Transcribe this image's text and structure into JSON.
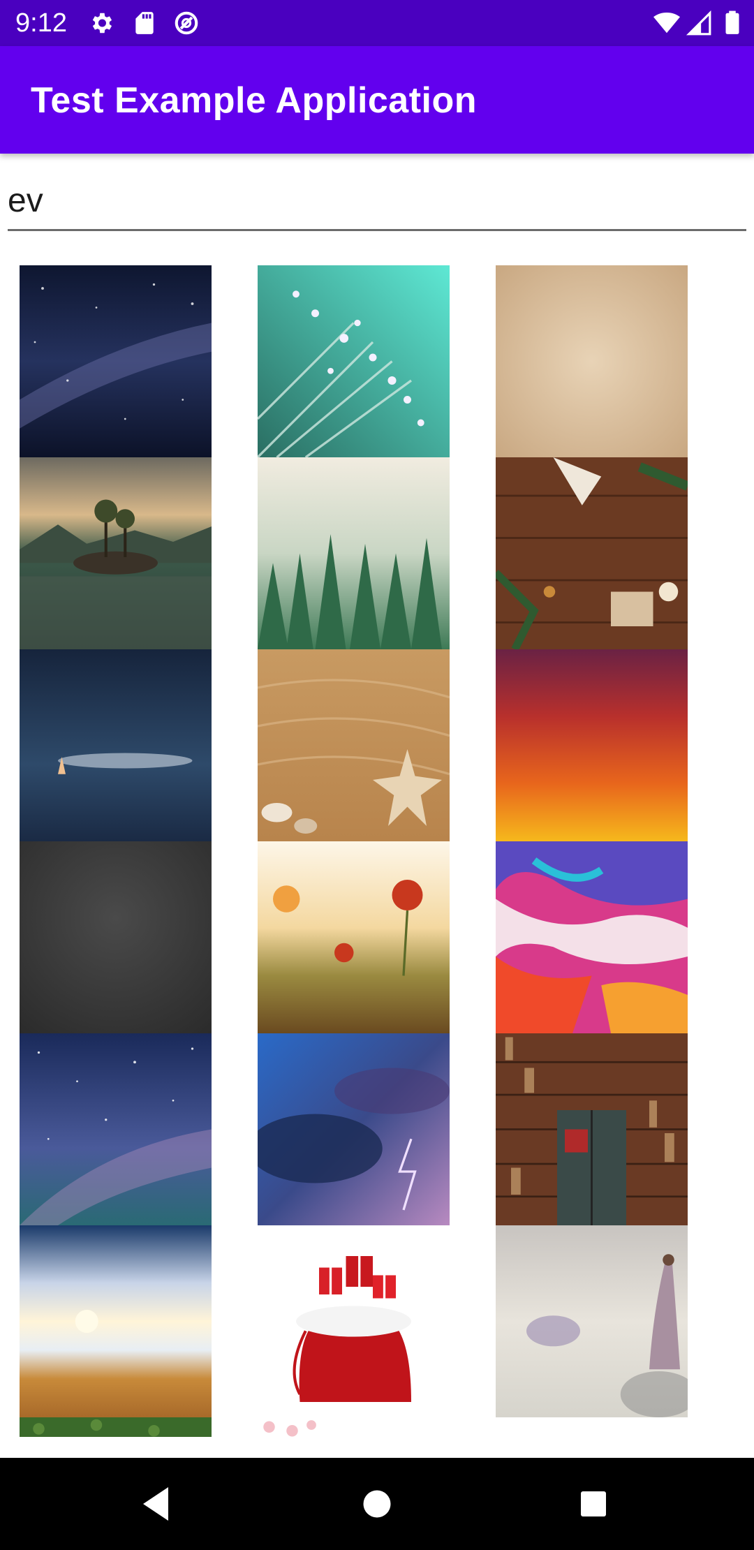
{
  "status_bar": {
    "time": "9:12",
    "left_icons": [
      "gear-icon",
      "sd-card-icon",
      "data-saver-icon"
    ],
    "right_icons": [
      "wifi-icon",
      "cell-signal-icon",
      "battery-icon"
    ]
  },
  "app_bar": {
    "title": "Test Example Application",
    "color": "#6200ee"
  },
  "search": {
    "value": "ev"
  },
  "gallery": {
    "columns": 3,
    "images": [
      {
        "name": "milky-way-night-sky"
      },
      {
        "name": "dandelion-dew-drops"
      },
      {
        "name": "parchment-texture"
      },
      {
        "name": "lake-island-trees"
      },
      {
        "name": "misty-pine-forest"
      },
      {
        "name": "christmas-wood-table"
      },
      {
        "name": "night-sea-boat"
      },
      {
        "name": "sand-starfish-shells"
      },
      {
        "name": "sunset-gradient-sky"
      },
      {
        "name": "chalkboard-texture"
      },
      {
        "name": "poppy-field"
      },
      {
        "name": "colorful-paint-strokes"
      },
      {
        "name": "starry-galaxy-sky"
      },
      {
        "name": "storm-clouds-lightning"
      },
      {
        "name": "bookshelf-door"
      },
      {
        "name": "beach-sunset-waves"
      },
      {
        "name": "santa-gift-sack"
      },
      {
        "name": "cloud-fantasy-woman"
      },
      {
        "name": "green-grass"
      },
      {
        "name": "pink-blossoms"
      },
      {
        "name": "white-partial"
      }
    ]
  },
  "nav_bar": {
    "buttons": [
      "back-icon",
      "home-icon",
      "recents-icon"
    ]
  }
}
